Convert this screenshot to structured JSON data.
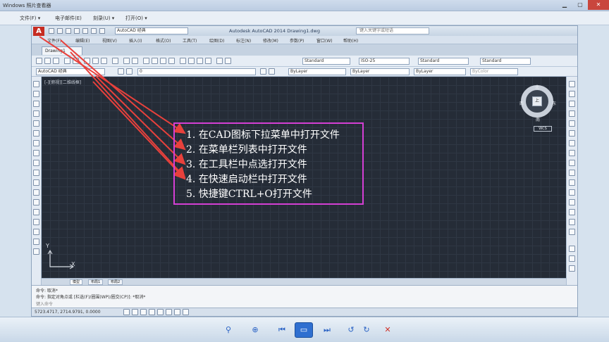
{
  "viewer": {
    "title": "Windows 照片查看器",
    "menu": [
      "文件(F) ▾",
      "电子邮件(E)",
      "刻录(U) ▾",
      "打开(O) ▾"
    ],
    "controls": [
      "▁",
      "▢",
      "✕"
    ]
  },
  "cad": {
    "logo": "A",
    "app_title": "Autodesk AutoCAD 2014    Drawing1.dwg",
    "workspace": "AutoCAD 经典",
    "search_placeholder": "键入关键字或短语",
    "menu": [
      "文件(F)",
      "编辑(E)",
      "视图(V)",
      "插入(I)",
      "格式(O)",
      "工具(T)",
      "绘图(D)",
      "标注(N)",
      "修改(M)",
      "参数(P)",
      "窗口(W)",
      "帮助(H)"
    ],
    "doc_tab": "Drawing1",
    "text_style": "Standard",
    "dim_style": "ISO-25",
    "table_style": "Standard",
    "mleader_style": "Standard",
    "workspace_combo": "AutoCAD 经典",
    "layer": "0",
    "color": "ByLayer",
    "linetype": "ByLayer",
    "lineweight": "ByLayer",
    "plotstyle": "ByColor",
    "view_label": "[-][俯视][二维线框]",
    "nav": {
      "north": "北",
      "south": "南",
      "west": "西",
      "east": "东",
      "cube": "上",
      "wcs": "WCS"
    },
    "ucs": {
      "y": "Y",
      "x": "X"
    },
    "layout_tabs": [
      "模型",
      "布局1",
      "布局2"
    ],
    "command_history": [
      "命令: 取消*",
      "命令: 指定对角点或 [栏选(F)/圈围(WP)/圈交(CP)]: *取消*"
    ],
    "command_prompt": "键入命令",
    "status_coords": "5723.4717, 2714.9791, 0.0000"
  },
  "annotation": {
    "steps": [
      "1. 在CAD图标下拉菜单中打开文件",
      "2. 在菜单栏列表中打开文件",
      "3. 在工具栏中点选打开文件",
      "4. 在快速启动栏中打开文件",
      "5. 快捷键CTRL+O打开文件"
    ],
    "border_color": "#d43fd4",
    "arrow_color": "#e8413c"
  },
  "viewer_bottom": {
    "buttons": [
      "zoom-icon",
      "fit-icon",
      "prev-icon",
      "slideshow-icon",
      "next-icon",
      "rotate-ccw-icon",
      "rotate-cw-icon",
      "delete-icon"
    ]
  }
}
